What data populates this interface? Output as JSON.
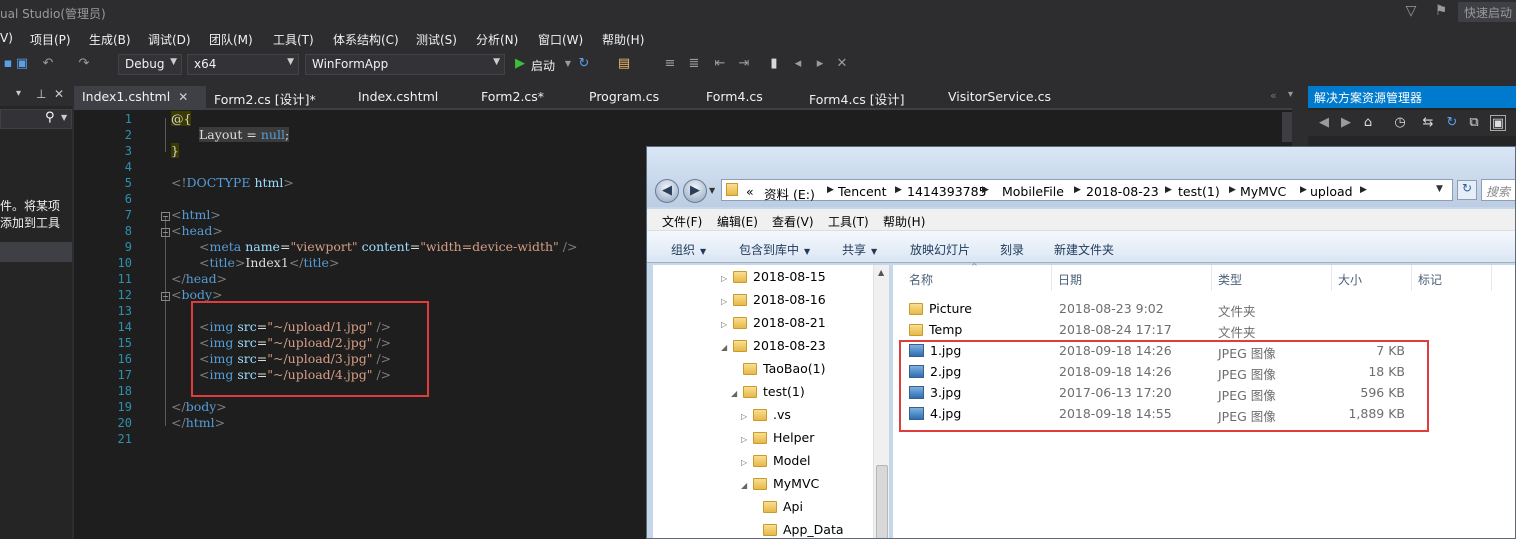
{
  "titlebar": {
    "title": "ual Studio(管理员)",
    "quick_launch": "快速启动"
  },
  "menubar": {
    "items": [
      "V)",
      "项目(P)",
      "生成(B)",
      "调试(D)",
      "团队(M)",
      "工具(T)",
      "体系结构(C)",
      "测试(S)",
      "分析(N)",
      "窗口(W)",
      "帮助(H)"
    ]
  },
  "toolbar": {
    "configuration": "Debug",
    "platform": "x64",
    "startup_project": "WinFormApp",
    "start_label": "启动"
  },
  "left_panel": {
    "text_line1": "件。将某项",
    "text_line2": "添加到工具"
  },
  "editor_tabs": [
    {
      "label": "Index1.cshtml",
      "active": true
    },
    {
      "label": "Form2.cs [设计]*"
    },
    {
      "label": "Index.cshtml"
    },
    {
      "label": "Form2.cs*"
    },
    {
      "label": "Program.cs"
    },
    {
      "label": "Form4.cs"
    },
    {
      "label": "Form4.cs [设计]"
    },
    {
      "label": "VisitorService.cs"
    }
  ],
  "editor": {
    "line_numbers": [
      "1",
      "2",
      "3",
      "4",
      "5",
      "6",
      "7",
      "8",
      "9",
      "10",
      "11",
      "12",
      "13",
      "14",
      "15",
      "16",
      "17",
      "18",
      "19",
      "20",
      "21"
    ],
    "code": {
      "l1": "@{",
      "l2_a": "Layout",
      "l2_b": " = ",
      "l2_c": "null",
      "l2_d": ";",
      "l3": "}",
      "l5_a": "<!",
      "l5_b": "DOCTYPE",
      "l5_c": " html",
      "l5_d": ">",
      "l7": "html",
      "l8": "head",
      "l9_attr1": "name",
      "l9_val1": "\"viewport\"",
      "l9_attr2": "content",
      "l9_val2": "\"width=device-width\"",
      "l10_text": "Index1",
      "l14": "\"~/upload/1.jpg\"",
      "l15": "\"~/upload/2.jpg\"",
      "l16": "\"~/upload/3.jpg\"",
      "l17": "\"~/upload/4.jpg\""
    }
  },
  "solution_explorer": {
    "title": "解决方案资源管理器"
  },
  "explorer": {
    "breadcrumb": [
      "«",
      "资料 (E:)",
      "Tencent",
      "1414393785",
      "MobileFile",
      "2018-08-23",
      "test(1)",
      "MyMVC",
      "upload"
    ],
    "search_placeholder": "搜索",
    "menu": [
      "文件(F)",
      "编辑(E)",
      "查看(V)",
      "工具(T)",
      "帮助(H)"
    ],
    "commands": [
      "组织",
      "包含到库中",
      "共享",
      "放映幻灯片",
      "刻录",
      "新建文件夹"
    ],
    "tree": [
      {
        "label": "2018-08-15",
        "expander": "▷"
      },
      {
        "label": "2018-08-16",
        "expander": "▷"
      },
      {
        "label": "2018-08-21",
        "expander": "▷"
      },
      {
        "label": "2018-08-23",
        "expander": "◢"
      },
      {
        "label": "TaoBao(1)",
        "expander": ""
      },
      {
        "label": "test(1)",
        "expander": "◢"
      },
      {
        "label": ".vs",
        "expander": "▷"
      },
      {
        "label": "Helper",
        "expander": "▷"
      },
      {
        "label": "Model",
        "expander": "▷"
      },
      {
        "label": "MyMVC",
        "expander": "◢"
      },
      {
        "label": "Api",
        "expander": ""
      },
      {
        "label": "App_Data",
        "expander": ""
      }
    ],
    "columns": [
      "名称",
      "日期",
      "类型",
      "大小",
      "标记"
    ],
    "files": [
      {
        "name": "Picture",
        "date": "2018-08-23 9:02",
        "type": "文件夹",
        "size": "",
        "icon": "folder-icon"
      },
      {
        "name": "Temp",
        "date": "2018-08-24 17:17",
        "type": "文件夹",
        "size": "",
        "icon": "folder-icon"
      },
      {
        "name": "1.jpg",
        "date": "2018-09-18 14:26",
        "type": "JPEG 图像",
        "size": "7 KB",
        "icon": "image-file-icon"
      },
      {
        "name": "2.jpg",
        "date": "2018-09-18 14:26",
        "type": "JPEG 图像",
        "size": "18 KB",
        "icon": "image-file-icon"
      },
      {
        "name": "3.jpg",
        "date": "2017-06-13 17:20",
        "type": "JPEG 图像",
        "size": "596 KB",
        "icon": "image-file-icon"
      },
      {
        "name": "4.jpg",
        "date": "2018-09-18 14:55",
        "type": "JPEG 图像",
        "size": "1,889 KB",
        "icon": "image-file-icon"
      }
    ]
  },
  "colors": {
    "vs_background": "#2d2d30",
    "editor_background": "#1e1e1e",
    "accent": "#007acc",
    "highlight_box": "#e03c3c",
    "keyword": "#569cd6",
    "string": "#d69d85"
  }
}
